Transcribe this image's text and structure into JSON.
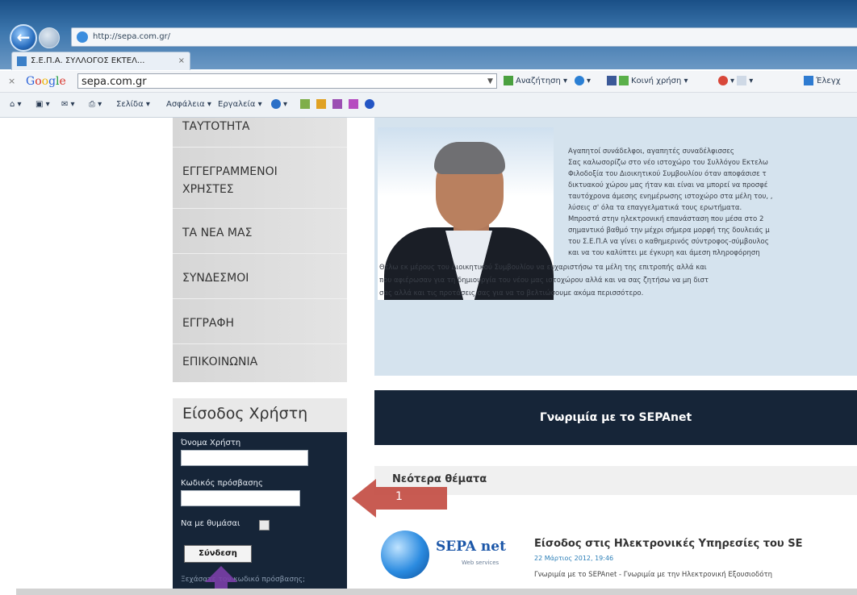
{
  "browser": {
    "url": "http://sepa.com.gr/",
    "tab_title": "Σ.Ε.Π.Α. ΣΥΛΛΟΓΟΣ ΕΚΤΕΛ...",
    "tab_close": "×",
    "google_close": "×",
    "google_logo": [
      "G",
      "o",
      "o",
      "g",
      "l",
      "e"
    ],
    "google_query": "sepa.com.gr",
    "google_items": [
      "Αναζήτηση ▾",
      "Κοινή χρήση ▾",
      "Έλεγχ"
    ],
    "command_items": [
      "Σελίδα ▾",
      "Ασφάλεια ▾",
      "Εργαλεία ▾"
    ]
  },
  "menu": {
    "items": [
      "ΤΑΥΤΟΤΗΤΑ",
      "ΕΓΓΕΓΡΑΜΜΕΝΟΙ",
      "ΧΡΗΣΤΕΣ",
      "ΤΑ ΝΕΑ ΜΑΣ",
      "ΣΥΝΔΕΣΜΟΙ",
      "ΕΓΓΡΑΦΗ",
      "ΕΠΙΚΟΙΝΩΝΙΑ"
    ]
  },
  "login": {
    "title": "Είσοδος Χρήστη",
    "username_label": "Όνομα Χρήστη",
    "password_label": "Κωδικός πρόσβασης",
    "remember_label": "Να με θυμάσαι",
    "submit_label": "Σύνδεση",
    "forgot_label": "Ξεχάσατε τον κωδικό πρόσβασης;"
  },
  "welcome": {
    "lines": [
      "Αγαπητοί συνάδελφοι, αγαπητές συναδέλφισσες",
      "Σας καλωσορίζω στο νέο ιστοχώρο του Συλλόγου Εκτελω",
      "Φιλοδοξία του Διοικητικού Συμβουλίου όταν αποφάσισε τ",
      "δικτυακού χώρου μας ήταν και είναι να μπορεί να προσφέ",
      "ταυτόχρονα άμεσης ενημέρωσης ιστοχώρο στα μέλη του, ,",
      "λύσεις σ' όλα τα επαγγελματικά τους ερωτήματα.",
      "Μπροστά στην ηλεκτρονική επανάσταση που μέσα στο 2",
      "σημαντικό βαθμό την μέχρι σήμερα μορφή της δουλειάς μ",
      "του Σ.Ε.Π.Α να γίνει ο καθημερινός σύντροφος-σύμβουλος",
      "και να του καλύπτει με έγκυρη και άμεση πληροφόρηση ",
      "Θέλω εκ μέρους του Διοικητικού Συμβουλίου να ευχαριστήσω τα μέλη της επιτροπής αλλά και",
      "που αφιέρωσαν για τη δημιουργία του νέου μας ιστοχώρου αλλά και να σας ζητήσω να μη διστ",
      "σας αλλά και τις προτάσεις σας για να το βελτιώσουμε ακόμα περισσότερο."
    ]
  },
  "banner": {
    "label": "Γνωριμία με το SEPAnet"
  },
  "latest": {
    "title": "Νεότερα θέματα",
    "annotation_number": "1",
    "logo_text": "SEPA net",
    "logo_sub": "Web services",
    "news_title": "Είσοδος στις Ηλεκτρονικές Υπηρεσίες του SE",
    "news_date": "22 Μάρτιος 2012, 19:46",
    "news_desc": "Γνωριμία με το SEPAnet - Γνωριμία με την Ηλεκτρονική Εξουσιοδότη"
  },
  "colors": {
    "navy": "#162538",
    "annotation_red": "#c2493f",
    "annotation_purple": "#7a3fa8"
  }
}
